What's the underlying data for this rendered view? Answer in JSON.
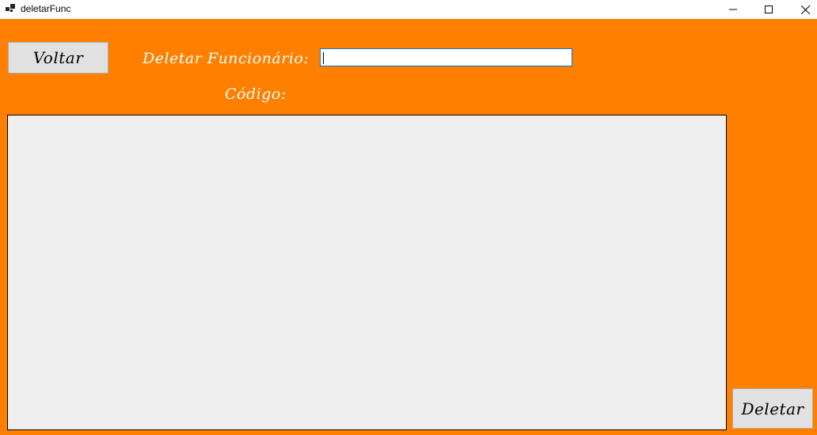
{
  "window": {
    "title": "deletarFunc",
    "controls": {
      "minimize_icon": "minimize-icon",
      "maximize_icon": "maximize-icon",
      "close_icon": "close-icon"
    }
  },
  "form": {
    "back_button_label": "Voltar",
    "label_line1": "Deletar Funcionário:",
    "label_line2": "Código:",
    "code_input_value": "",
    "delete_button_label": "Deletar"
  },
  "colors": {
    "background": "#ff8000",
    "label_text": "#ffffff",
    "grid_background": "#efefef",
    "button_background": "#e1e1e1",
    "input_focus_border": "#0078d7"
  }
}
